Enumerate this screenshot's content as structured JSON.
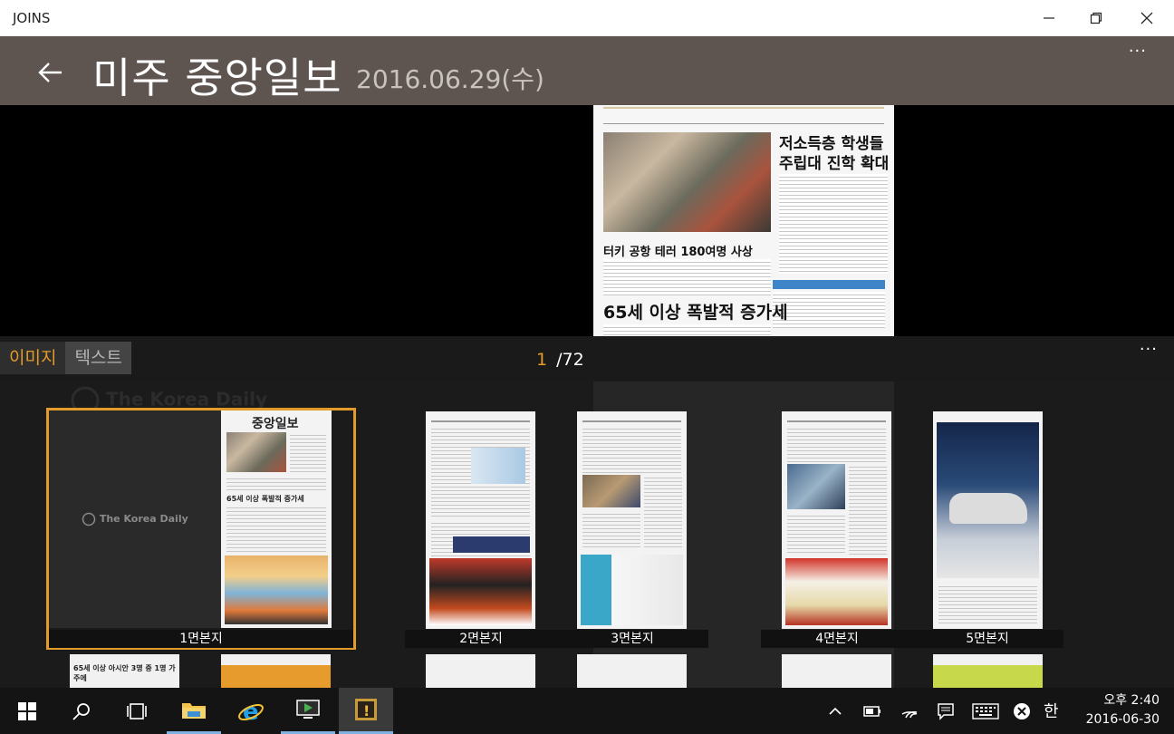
{
  "window": {
    "title": "JOINS"
  },
  "header": {
    "title": "미주 중앙일보",
    "date": "2016.06.29(수)",
    "more": "···"
  },
  "preview": {
    "headline1": "저소득층 학생들",
    "headline2": "주립대 진학 확대",
    "headline3": "터키 공항 테러 180여명 사상",
    "headline4": "65세 이상 폭발적 증가세"
  },
  "toolbar": {
    "tabs": [
      {
        "label": "이미지"
      },
      {
        "label": "텍스트"
      }
    ],
    "current_page": "1",
    "total_pages": "/72",
    "more": "···"
  },
  "thumbs": {
    "watermark": "The Korea Daily",
    "items": [
      {
        "label": "1면본지",
        "masthead": "중앙일보",
        "sub_headline": "65세 이상 폭발적 증가세"
      },
      {
        "label": "2면본지"
      },
      {
        "label": "3면본지"
      },
      {
        "label": "4면본지"
      },
      {
        "label": "5면본지"
      }
    ],
    "row2_1": "65세 이상 아시안 3명 중 1명 가주에"
  },
  "taskbar": {
    "time_period": "오후",
    "time": "2:40",
    "date": "2016-06-30",
    "ime": "한"
  },
  "colors": {
    "accent": "#e39b2a",
    "header_bg": "#5f5550"
  }
}
